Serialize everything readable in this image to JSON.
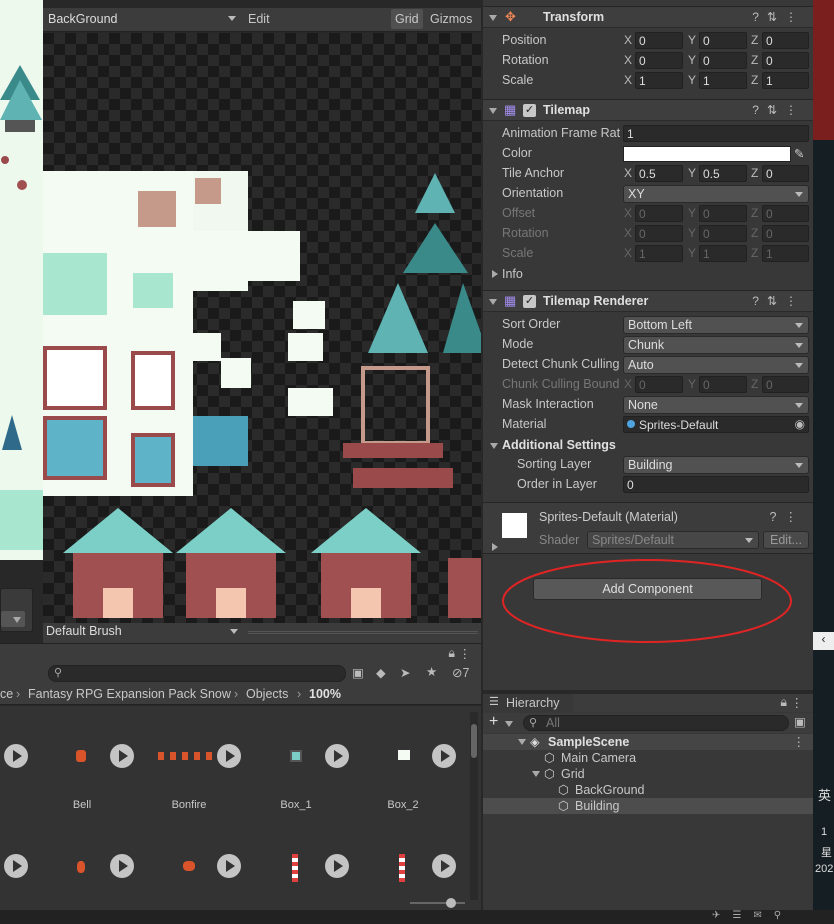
{
  "palette": {
    "tilemap_select": "BackGround",
    "edit_label": "Edit",
    "grid_label": "Grid",
    "gizmos_label": "Gizmos",
    "brush_select": "Default Brush"
  },
  "project": {
    "badge_count": "7",
    "breadcrumb": [
      "ce",
      "Fantasy RPG Expansion Pack Snow",
      "Objects"
    ],
    "zoom": "100%",
    "assets_row1": [
      "",
      "Bell",
      "Bonfire",
      "Box_1",
      "Box_2"
    ]
  },
  "inspector": {
    "transform": {
      "title": "Transform",
      "position_label": "Position",
      "rotation_label": "Rotation",
      "scale_label": "Scale",
      "position": [
        "0",
        "0",
        "0"
      ],
      "rotation": [
        "0",
        "0",
        "0"
      ],
      "scale": [
        "1",
        "1",
        "1"
      ]
    },
    "tilemap": {
      "title": "Tilemap",
      "anim_label": "Animation Frame Rat",
      "anim_value": "1",
      "color_label": "Color",
      "anchor_label": "Tile Anchor",
      "anchor": [
        "0.5",
        "0.5",
        "0"
      ],
      "orientation_label": "Orientation",
      "orientation_value": "XY",
      "offset_label": "Offset",
      "offset": [
        "0",
        "0",
        "0"
      ],
      "rotation_label": "Rotation",
      "rotation": [
        "0",
        "0",
        "0"
      ],
      "scale_label": "Scale",
      "scale": [
        "1",
        "1",
        "1"
      ],
      "info_label": "Info"
    },
    "renderer": {
      "title": "Tilemap Renderer",
      "sort_label": "Sort Order",
      "sort_value": "Bottom Left",
      "mode_label": "Mode",
      "mode_value": "Chunk",
      "detect_label": "Detect Chunk Culling",
      "detect_value": "Auto",
      "bounds_label": "Chunk Culling Bound",
      "bounds": [
        "0",
        "0",
        "0"
      ],
      "mask_label": "Mask Interaction",
      "mask_value": "None",
      "material_label": "Material",
      "material_value": "Sprites-Default",
      "additional_label": "Additional Settings",
      "sorting_layer_label": "Sorting Layer",
      "sorting_layer_value": "Building",
      "order_label": "Order in Layer",
      "order_value": "0"
    },
    "material": {
      "title": "Sprites-Default (Material)",
      "shader_label": "Shader",
      "shader_value": "Sprites/Default",
      "edit_label": "Edit..."
    },
    "add_component": "Add Component"
  },
  "axes": {
    "x": "X",
    "y": "Y",
    "z": "Z"
  },
  "hierarchy": {
    "title": "Hierarchy",
    "search_placeholder": "All",
    "scene": "SampleScene",
    "items": [
      "Main Camera",
      "Grid",
      "BackGround",
      "Building"
    ]
  },
  "side_text": [
    "英",
    "1",
    "星",
    "202"
  ]
}
